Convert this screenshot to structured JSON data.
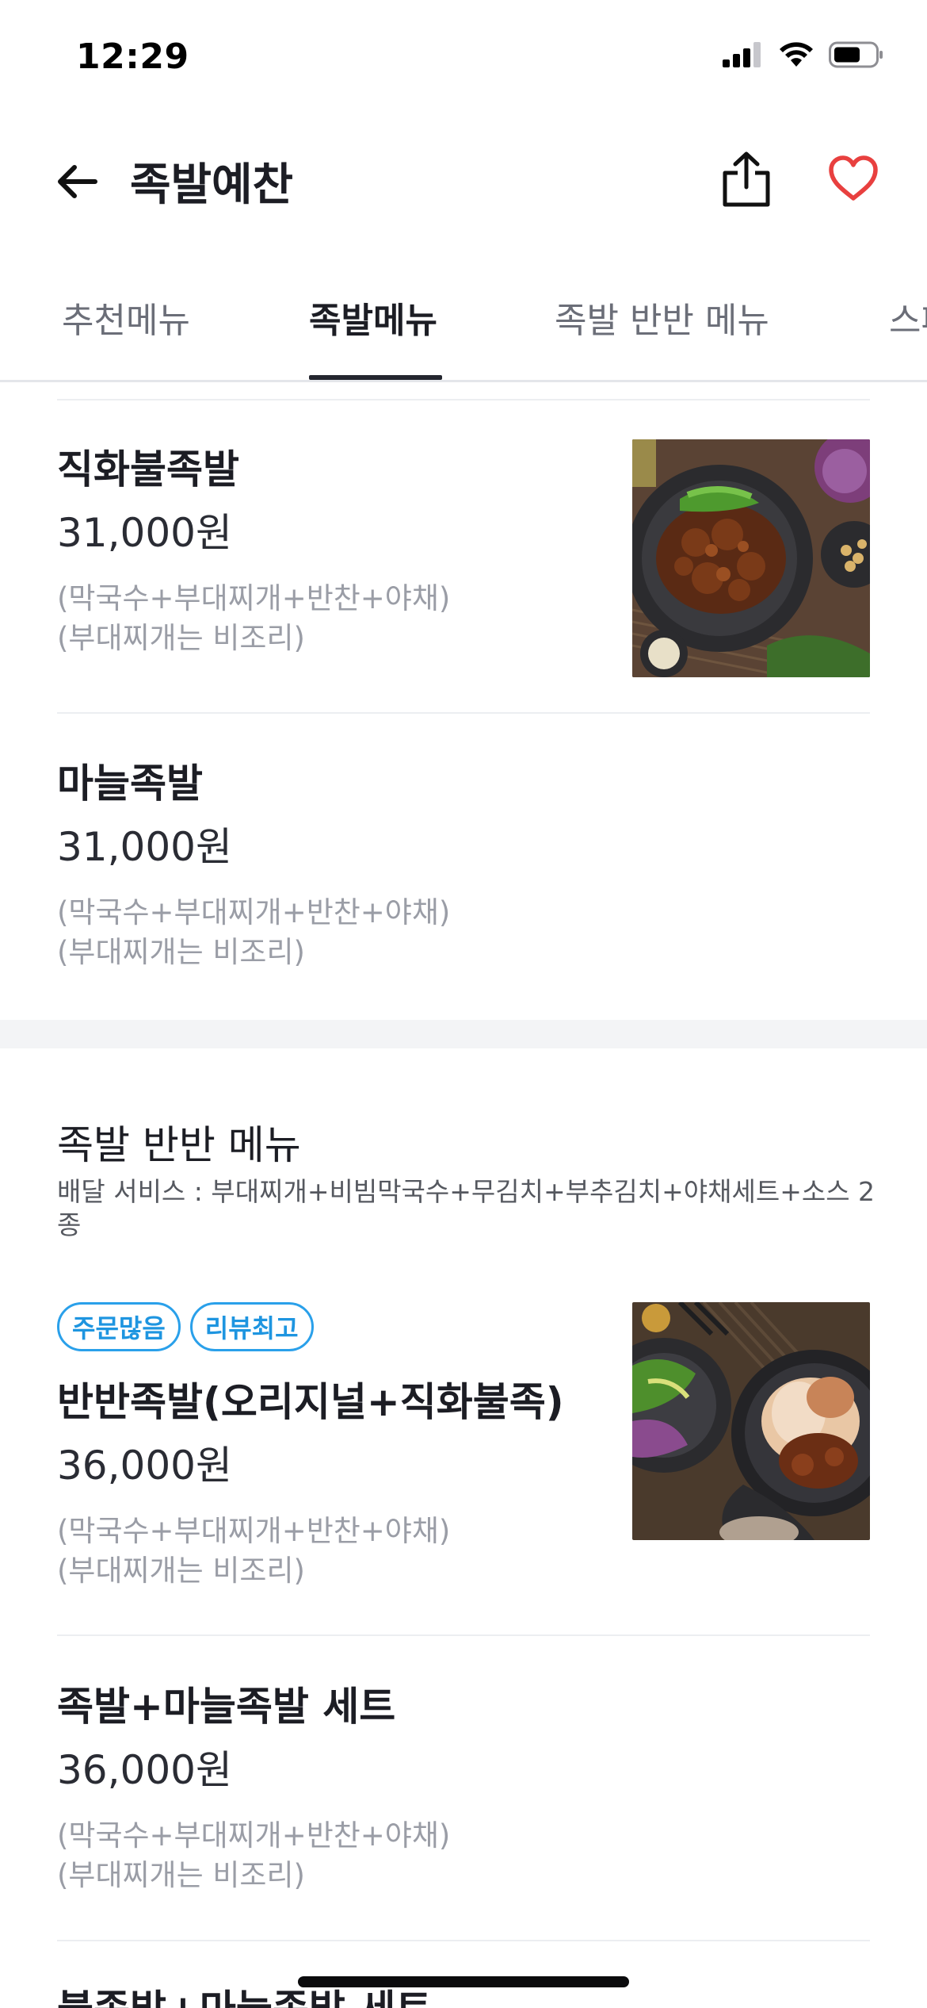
{
  "status_bar": {
    "time": "12:29"
  },
  "header": {
    "title": "족발예찬"
  },
  "tabs": [
    {
      "label": "추천메뉴"
    },
    {
      "label": "족발메뉴"
    },
    {
      "label": "족발 반반 메뉴"
    },
    {
      "label": "스페"
    }
  ],
  "active_tab": "족발메뉴",
  "menu_items": [
    {
      "name": "직화불족발",
      "price": "31,000원",
      "desc1": "(막국수+부대찌개+반찬+야채)",
      "desc2": "(부대찌개는 비조리)",
      "image": "spicy-grilled-jokbal-photo"
    },
    {
      "name": "마늘족발",
      "price": "31,000원",
      "desc1": "(막국수+부대찌개+반찬+야채)",
      "desc2": "(부대찌개는 비조리)"
    }
  ],
  "section": {
    "title": "족발 반반 메뉴",
    "desc": "배달 서비스 : 부대찌개+비빔막국수+무김치+부추김치+야채세트+소스 2종"
  },
  "section_items": [
    {
      "badges": [
        "주문많음",
        "리뷰최고"
      ],
      "name": "반반족발(오리지널+직화불족)",
      "price": "36,000원",
      "desc1": "(막국수+부대찌개+반찬+야채)",
      "desc2": "(부대찌개는 비조리)",
      "image": "half-half-jokbal-photo"
    },
    {
      "name": "족발+마늘족발 세트",
      "price": "36,000원",
      "desc1": "(막국수+부대찌개+반찬+야채)",
      "desc2": "(부대찌개는 비조리)"
    },
    {
      "name": "불족발+마늘족발 세트"
    }
  ],
  "colors": {
    "accent": "#1e95e0",
    "heart": "#e8403f",
    "text": "#1c1d24",
    "muted": "#9a9da6"
  }
}
